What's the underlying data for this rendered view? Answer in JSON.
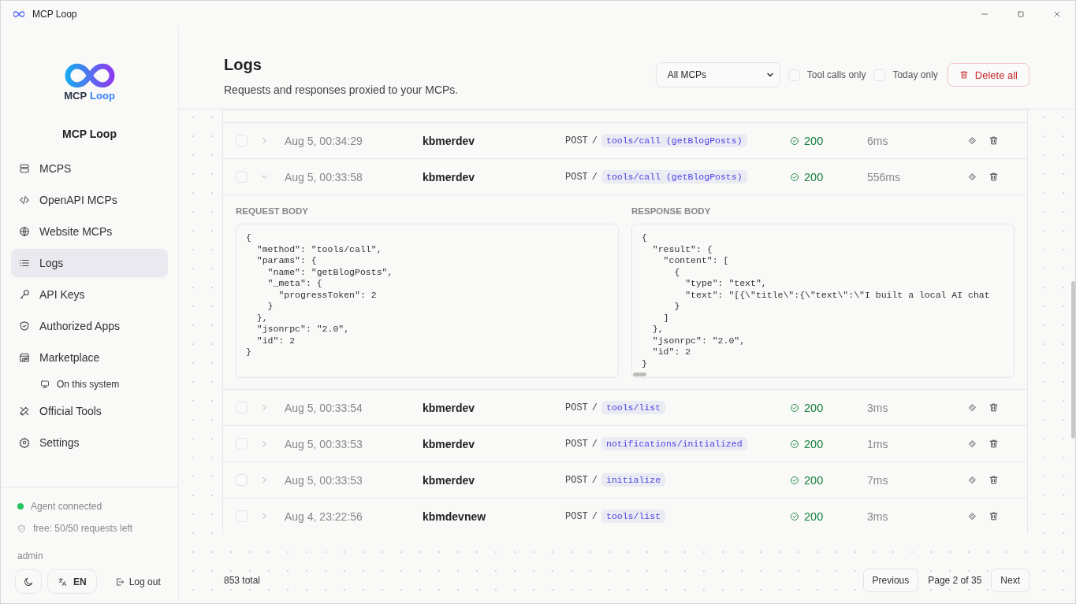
{
  "window": {
    "title": "MCP Loop"
  },
  "sidebar": {
    "logo": {
      "word1": "MCP",
      "word2": "Loop"
    },
    "app_name": "MCP Loop",
    "items": [
      {
        "label": "MCPS",
        "selected": false
      },
      {
        "label": "OpenAPI MCPs",
        "selected": false
      },
      {
        "label": "Website MCPs",
        "selected": false
      },
      {
        "label": "Logs",
        "selected": true
      },
      {
        "label": "API Keys",
        "selected": false
      },
      {
        "label": "Authorized Apps",
        "selected": false
      },
      {
        "label": "Marketplace",
        "selected": false,
        "children": [
          {
            "label": "On this system",
            "selected": false
          }
        ]
      },
      {
        "label": "Official Tools",
        "selected": false
      },
      {
        "label": "Settings",
        "selected": false
      }
    ],
    "agent": {
      "label": "Agent connected",
      "color": "#22c55e"
    },
    "quota": "free: 50/50 requests left",
    "user": "admin",
    "language": "EN",
    "logout": "Log out"
  },
  "header": {
    "title": "Logs",
    "subtitle": "Requests and responses proxied to your MCPs.",
    "filter": "All MCPs",
    "checkboxes": [
      {
        "label": "Tool calls only",
        "checked": false
      },
      {
        "label": "Today only",
        "checked": false
      }
    ],
    "delete_button": "Delete all"
  },
  "rows": [
    {
      "checked": false,
      "expanded": false,
      "time": "Aug 5, 00:34:29",
      "user": "kbmerdev",
      "method": "POST",
      "separator": "/",
      "path": "tools/call (getBlogPosts)",
      "status": "200",
      "success": true,
      "duration": "6ms"
    },
    {
      "checked": false,
      "expanded": true,
      "time": "Aug 5, 00:33:58",
      "user": "kbmerdev",
      "method": "POST",
      "separator": "/",
      "path": "tools/call (getBlogPosts)",
      "status": "200",
      "success": true,
      "duration": "556ms",
      "request_label": "REQUEST BODY",
      "response_label": "RESPONSE BODY",
      "request_body": [
        "{",
        "  \"method\": \"tools/call\",",
        "  \"params\": {",
        "    \"name\": \"getBlogPosts\",",
        "    \"_meta\": {",
        "      \"progressToken\": 2",
        "    }",
        "  },",
        "  \"jsonrpc\": \"2.0\",",
        "  \"id\": 2",
        "}"
      ],
      "response_body": [
        "{",
        "  \"result\": {",
        "    \"content\": [",
        "      {",
        "        \"type\": \"text\",",
        "        \"text\": \"[{\\\"title\\\":{\\\"text\\\":\\\"I built a local AI chat",
        "      }",
        "    ]",
        "  },",
        "  \"jsonrpc\": \"2.0\",",
        "  \"id\": 2",
        "}"
      ]
    },
    {
      "checked": false,
      "expanded": false,
      "time": "Aug 5, 00:33:54",
      "user": "kbmerdev",
      "method": "POST",
      "separator": "/",
      "path": "tools/list",
      "status": "200",
      "success": true,
      "duration": "3ms"
    },
    {
      "checked": false,
      "expanded": false,
      "time": "Aug 5, 00:33:53",
      "user": "kbmerdev",
      "method": "POST",
      "separator": "/",
      "path": "notifications/initialized",
      "status": "200",
      "success": true,
      "duration": "1ms"
    },
    {
      "checked": false,
      "expanded": false,
      "time": "Aug 5, 00:33:53",
      "user": "kbmerdev",
      "method": "POST",
      "separator": "/",
      "path": "initialize",
      "status": "200",
      "success": true,
      "duration": "7ms"
    },
    {
      "checked": false,
      "expanded": false,
      "time": "Aug 4, 23:22:56",
      "user": "kbmdevnew",
      "method": "POST",
      "separator": "/",
      "path": "tools/list",
      "status": "200",
      "success": true,
      "duration": "3ms"
    }
  ],
  "footer": {
    "total": "853 total",
    "previous": "Previous",
    "page": "Page 2 of 35",
    "next": "Next"
  }
}
